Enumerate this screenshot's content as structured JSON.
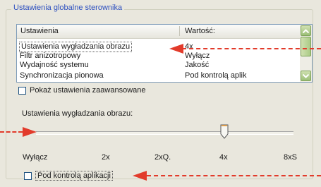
{
  "group": {
    "title": "Ustawienia globalne sterownika"
  },
  "list": {
    "headers": {
      "setting": "Ustawienia",
      "value": "Wartość:"
    },
    "rows": [
      {
        "setting": "Ustawienia wygładzania obrazu",
        "value": "4x"
      },
      {
        "setting": "Filtr anizotropowy",
        "value": "Wyłącz"
      },
      {
        "setting": "Wydajność systemu",
        "value": "Jakość"
      },
      {
        "setting": "Synchronizacja pionowa",
        "value": "Pod kontrolą aplik"
      }
    ]
  },
  "advanced": {
    "label": "Pokaż ustawienia zaawansowane",
    "checked": false
  },
  "slider": {
    "label": "Ustawienia wygładzania obrazu:",
    "ticks": [
      "Wyłącz",
      "2x",
      "2xQ.",
      "4x",
      "8xS"
    ],
    "selected": "4x"
  },
  "app_control": {
    "label": "Pod kontrolą aplikacji",
    "checked": false
  },
  "colors": {
    "annotation": "#e23b2b",
    "scroll_accent": "#9cbf78",
    "title": "#2c4fbf"
  }
}
